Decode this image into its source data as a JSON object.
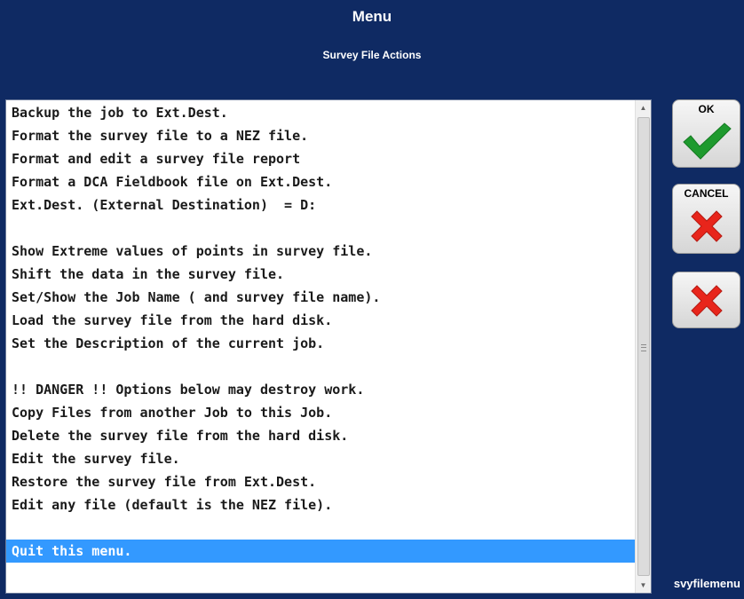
{
  "header": {
    "title": "Menu",
    "subtitle": "Survey File Actions"
  },
  "menu": {
    "items": [
      "Backup the job to Ext.Dest.",
      "Format the survey file to a NEZ file.",
      "Format and edit a survey file report",
      "Format a DCA Fieldbook file on Ext.Dest.",
      "Ext.Dest. (External Destination)  = D:",
      "",
      "Show Extreme values of points in survey file.",
      "Shift the data in the survey file.",
      "Set/Show the Job Name ( and survey file name).",
      "Load the survey file from the hard disk.",
      "Set the Description of the current job.",
      "",
      "!! DANGER !! Options below may destroy work.",
      "Copy Files from another Job to this Job.",
      "Delete the survey file from the hard disk.",
      "Edit the survey file.",
      "Restore the survey file from Ext.Dest.",
      "Edit any file (default is the NEZ file).",
      "",
      "Quit this menu."
    ],
    "selected_index": 19
  },
  "buttons": {
    "ok_label": "OK",
    "cancel_label": "CANCEL"
  },
  "footer": {
    "screen_name": "svyfilemenu"
  },
  "colors": {
    "background": "#0f2a63",
    "selection": "#3399ff",
    "check": "#1e9a2e",
    "cross": "#e8251b"
  },
  "icons": {
    "ok": "checkmark-icon",
    "cancel": "cross-icon",
    "extra": "cross-icon"
  }
}
